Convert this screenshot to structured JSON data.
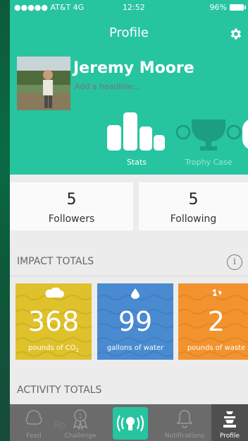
{
  "status_bar": {
    "carrier": "●●●●● AT&T  4G",
    "time": "12:52",
    "battery": "96%"
  },
  "header": {
    "title": "Profile",
    "settings_icon": "gear-icon"
  },
  "user": {
    "name": "Jeremy Moore",
    "headline_placeholder": "Add a headline..."
  },
  "profile_tabs": [
    {
      "label": "Stats",
      "icon": "bar-chart-icon",
      "active": true
    },
    {
      "label": "Trophy Case",
      "icon": "trophy-icon",
      "active": false
    }
  ],
  "follow": {
    "followers": {
      "count": "5",
      "label": "Followers"
    },
    "following": {
      "count": "5",
      "label": "Following"
    }
  },
  "impact": {
    "title": "IMPACT TOTALS",
    "tiles": [
      {
        "value": "368",
        "label": "pounds of CO",
        "label_subscript": "2",
        "icon": "cloud-icon",
        "color": "#dfc12b"
      },
      {
        "value": "99",
        "label": "gallons of water",
        "icon": "water-drop-icon",
        "color": "#4a8ad0"
      },
      {
        "value": "2",
        "label": "pounds of waste",
        "icon": "recycle-icon",
        "color": "#f2932e"
      }
    ]
  },
  "activity": {
    "title": "ACTIVITY TOTALS"
  },
  "tab_bar": {
    "items": [
      {
        "label": "Feed",
        "icon": "feed-icon"
      },
      {
        "label": "Challenge",
        "icon": "challenge-icon"
      },
      {
        "label": "",
        "icon": "center-action-icon"
      },
      {
        "label": "Notifications",
        "icon": "bell-icon"
      },
      {
        "label": "Profile",
        "icon": "profile-icon",
        "active": true
      }
    ],
    "overlay_text": "Ro"
  },
  "colors": {
    "accent": "#27c4a0",
    "co2": "#dfc12b",
    "water": "#4a8ad0",
    "waste": "#f2932e"
  }
}
